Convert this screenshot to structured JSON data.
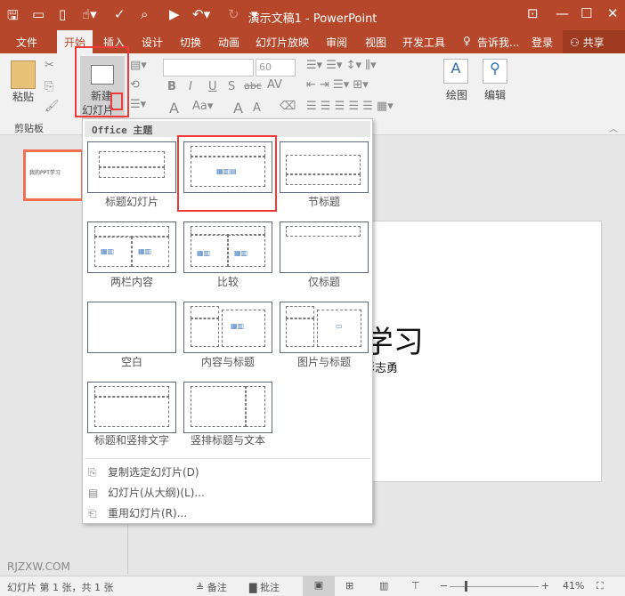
{
  "window": {
    "title": "演示文稿1 - PowerPoint"
  },
  "quick_access": [
    "save-icon",
    "open-icon",
    "new-icon",
    "touch-mode-icon",
    "spelling-icon",
    "preview-icon",
    "slideshow-icon",
    "undo-icon",
    "redo-icon",
    "customize-icon"
  ],
  "tabs": [
    "文件",
    "开始",
    "插入",
    "设计",
    "切换",
    "动画",
    "幻灯片放映",
    "审阅",
    "视图",
    "开发工具"
  ],
  "tell_me": "告诉我...",
  "login": "登录",
  "share": "共享",
  "ribbon": {
    "paste": "粘贴",
    "clipboard_group": "剪贴板",
    "new_slide_line1": "新建",
    "new_slide_line2": "幻灯片",
    "font_size": "60",
    "drawing": "绘图",
    "editing": "编辑"
  },
  "dropdown": {
    "header": "Office 主题",
    "layouts": [
      "标题幻灯片",
      "",
      "节标题",
      "两栏内容",
      "比较",
      "仅标题",
      "空白",
      "内容与标题",
      "图片与标题",
      "标题和竖排文字",
      "竖排标题与文本"
    ],
    "menu": [
      "复制选定幻灯片(D)",
      "幻灯片(从大纲)(L)...",
      "重用幻灯片(R)..."
    ]
  },
  "slide": {
    "title": "PPT学习",
    "subtitle": "彭志勇",
    "thumb_title": "我的PPT学习"
  },
  "watermark": "RJZXW.COM",
  "status": {
    "slide_info": "幻灯片 第 1 张，共 1 张",
    "notes": "备注",
    "comments": "批注",
    "zoom": "41%"
  }
}
